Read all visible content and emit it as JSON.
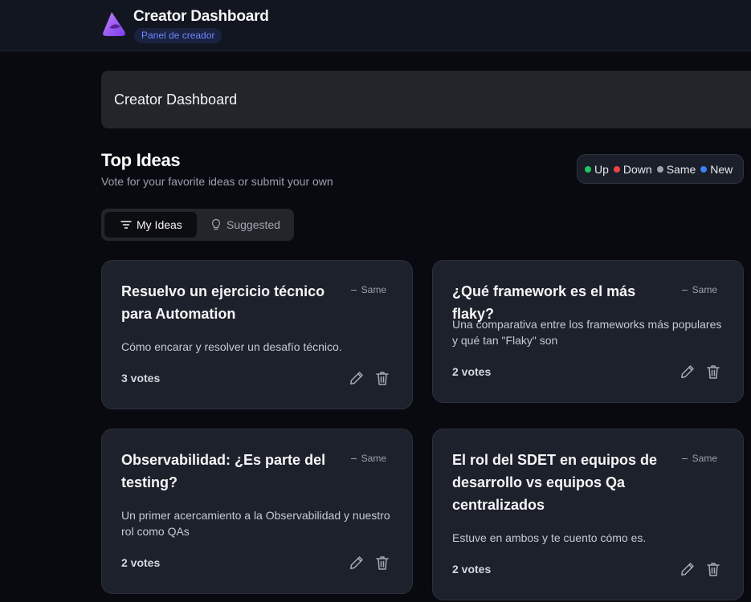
{
  "header": {
    "title": "Creator Dashboard",
    "badge": "Panel de creador",
    "logo_icon": "logo-icon"
  },
  "hero": {
    "title": "Creator Dashboard"
  },
  "section": {
    "title": "Top Ideas",
    "subtitle": "Vote for your favorite ideas or submit your own"
  },
  "legend": [
    {
      "label": "Up",
      "color": "#22c55e"
    },
    {
      "label": "Down",
      "color": "#ef4444"
    },
    {
      "label": "Same",
      "color": "#9ca3af"
    },
    {
      "label": "New",
      "color": "#3b82f6"
    }
  ],
  "tabs": [
    {
      "label": "My Ideas",
      "icon": "filter-icon",
      "active": true
    },
    {
      "label": "Suggested",
      "icon": "lightbulb-icon",
      "active": false
    }
  ],
  "ideas": [
    {
      "title": "Resuelvo un ejercicio técnico para Automation",
      "status": "Same",
      "description": "Cómo encarar y resolver un desafío técnico.",
      "votes": "3 votes"
    },
    {
      "title": "¿Qué framework es el más flaky?",
      "status": "Same",
      "description": "Una comparativa entre los frameworks más populares y qué tan \"Flaky\" son",
      "votes": "2 votes"
    },
    {
      "title": "Observabilidad: ¿Es parte del testing?",
      "status": "Same",
      "description": "Un primer acercamiento a la Observabilidad y nuestro rol como QAs",
      "votes": "2 votes"
    },
    {
      "title": "El rol del SDET en equipos de desarrollo vs equipos Qa centralizados",
      "status": "Same",
      "description": "Estuve en ambos y te cuento cómo es.",
      "votes": "2 votes"
    }
  ],
  "actions": {
    "edit_icon": "pencil-icon",
    "delete_icon": "trash-icon"
  }
}
